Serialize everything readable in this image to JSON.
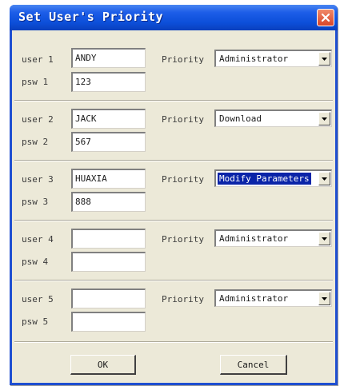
{
  "window": {
    "title": "Set User's Priority"
  },
  "users": [
    {
      "user_label": "user 1",
      "psw_label": "psw 1",
      "user_value": "ANDY",
      "psw_value": "123",
      "priority_label": "Priority",
      "priority_value": "Administrator",
      "priority_selected": false
    },
    {
      "user_label": "user 2",
      "psw_label": "psw 2",
      "user_value": "JACK",
      "psw_value": "567",
      "priority_label": "Priority",
      "priority_value": "Download",
      "priority_selected": false
    },
    {
      "user_label": "user 3",
      "psw_label": "psw 3",
      "user_value": "HUAXIA",
      "psw_value": "888",
      "priority_label": "Priority",
      "priority_value": "Modify Parameters",
      "priority_selected": true
    },
    {
      "user_label": "user 4",
      "psw_label": "psw 4",
      "user_value": "",
      "psw_value": "",
      "priority_label": "Priority",
      "priority_value": "Administrator",
      "priority_selected": false
    },
    {
      "user_label": "user 5",
      "psw_label": "psw 5",
      "user_value": "",
      "psw_value": "",
      "priority_label": "Priority",
      "priority_value": "Administrator",
      "priority_selected": false
    }
  ],
  "buttons": {
    "ok": "OK",
    "cancel": "Cancel"
  },
  "icons": {
    "close": "close-icon",
    "dropdown": "chevron-down-icon"
  },
  "colors": {
    "titlebar": "#0c4fd9",
    "close_button": "#d8452a",
    "dialog_bg": "#ece9d8",
    "selection": "#0a24a8"
  }
}
